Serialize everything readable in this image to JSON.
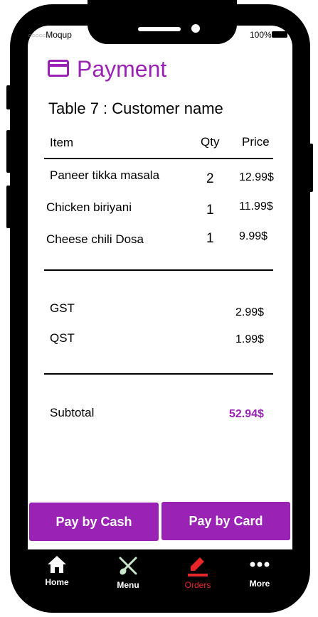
{
  "status": {
    "carrier_dots": "○○○○○",
    "carrier": "Moqup",
    "battery": "100%"
  },
  "page": {
    "title": "Payment",
    "table_label": "Table 7 : Customer name"
  },
  "order": {
    "headers": {
      "item": "Item",
      "qty": "Qty",
      "price": "Price"
    },
    "items": [
      {
        "name": "Paneer tikka masala",
        "qty": "2",
        "price": "12.99$"
      },
      {
        "name": "Chicken biriyani",
        "qty": "1",
        "price": "11.99$"
      },
      {
        "name": "Cheese chili Dosa",
        "qty": "1",
        "price": "9.99$"
      }
    ],
    "taxes": [
      {
        "name": "GST",
        "amount": "2.99$"
      },
      {
        "name": "QST",
        "amount": "1.99$"
      }
    ],
    "subtotal": {
      "label": "Subtotal",
      "amount": "52.94$"
    }
  },
  "actions": {
    "cash": "Pay by Cash",
    "card": "Pay by Card"
  },
  "nav": [
    {
      "label": "Home",
      "icon": "home-icon"
    },
    {
      "label": "Menu",
      "icon": "utensils-icon"
    },
    {
      "label": "Orders",
      "icon": "pencil-icon",
      "active": true
    },
    {
      "label": "More",
      "icon": "more-icon"
    }
  ],
  "colors": {
    "accent": "#9a22b5",
    "active_nav": "#e8262a",
    "utensils": "#c8e6c9"
  }
}
